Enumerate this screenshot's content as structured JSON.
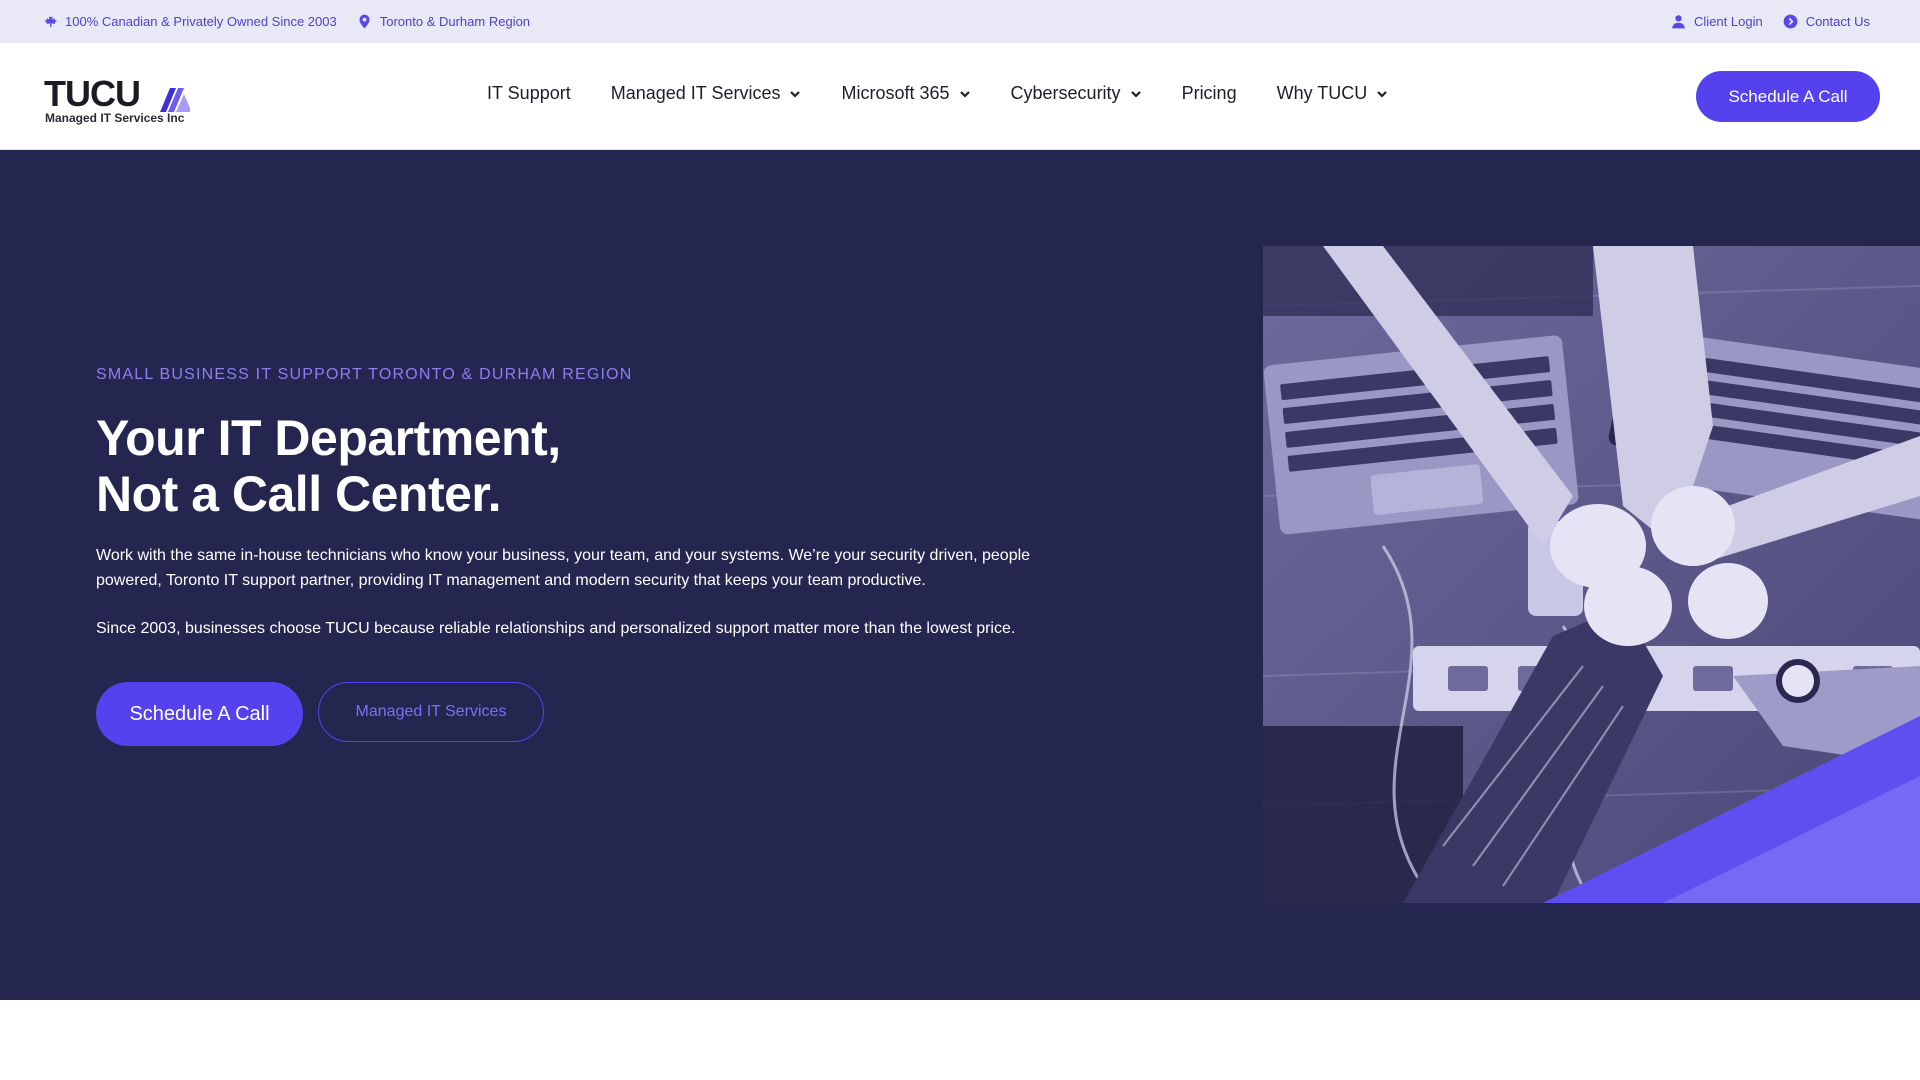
{
  "topbar": {
    "left": [
      {
        "icon": "maple-leaf-icon",
        "label": "100% Canadian & Privately Owned Since 2003"
      },
      {
        "icon": "location-pin-icon",
        "label": "Toronto & Durham Region"
      }
    ],
    "right": [
      {
        "icon": "user-icon",
        "label": "Client Login"
      },
      {
        "icon": "arrow-circle-icon",
        "label": "Contact Us"
      }
    ]
  },
  "header": {
    "logo": {
      "word": "TUCU",
      "sub": "Managed IT Services Inc"
    },
    "nav": [
      {
        "label": "IT Support",
        "dropdown": false
      },
      {
        "label": "Managed IT Services",
        "dropdown": true
      },
      {
        "label": "Microsoft 365",
        "dropdown": true
      },
      {
        "label": "Cybersecurity",
        "dropdown": true
      },
      {
        "label": "Pricing",
        "dropdown": false
      },
      {
        "label": "Why TUCU",
        "dropdown": true
      }
    ],
    "cta_label": "Schedule A Call"
  },
  "hero": {
    "eyebrow": "SMALL BUSINESS IT SUPPORT TORONTO & DURHAM REGION",
    "headline_line1": "Your IT Department,",
    "headline_line2": "Not a Call Center.",
    "paragraph1": "Work with the same in-house technicians who know your business, your team, and your systems. We’re your security driven, people powered, Toronto IT support partner, providing IT management and modern security that keeps your team productive.",
    "paragraph2": "Since 2003, businesses choose TUCU because reliable relationships and personalized support matter more than the lowest price.",
    "primary_button": "Schedule A Call",
    "secondary_button": "Managed IT Services"
  },
  "colors": {
    "accent": "#5542ee",
    "hero_bg": "#252650",
    "topbar_bg": "#e9e8f6",
    "eyebrow": "#8c7ff2"
  }
}
